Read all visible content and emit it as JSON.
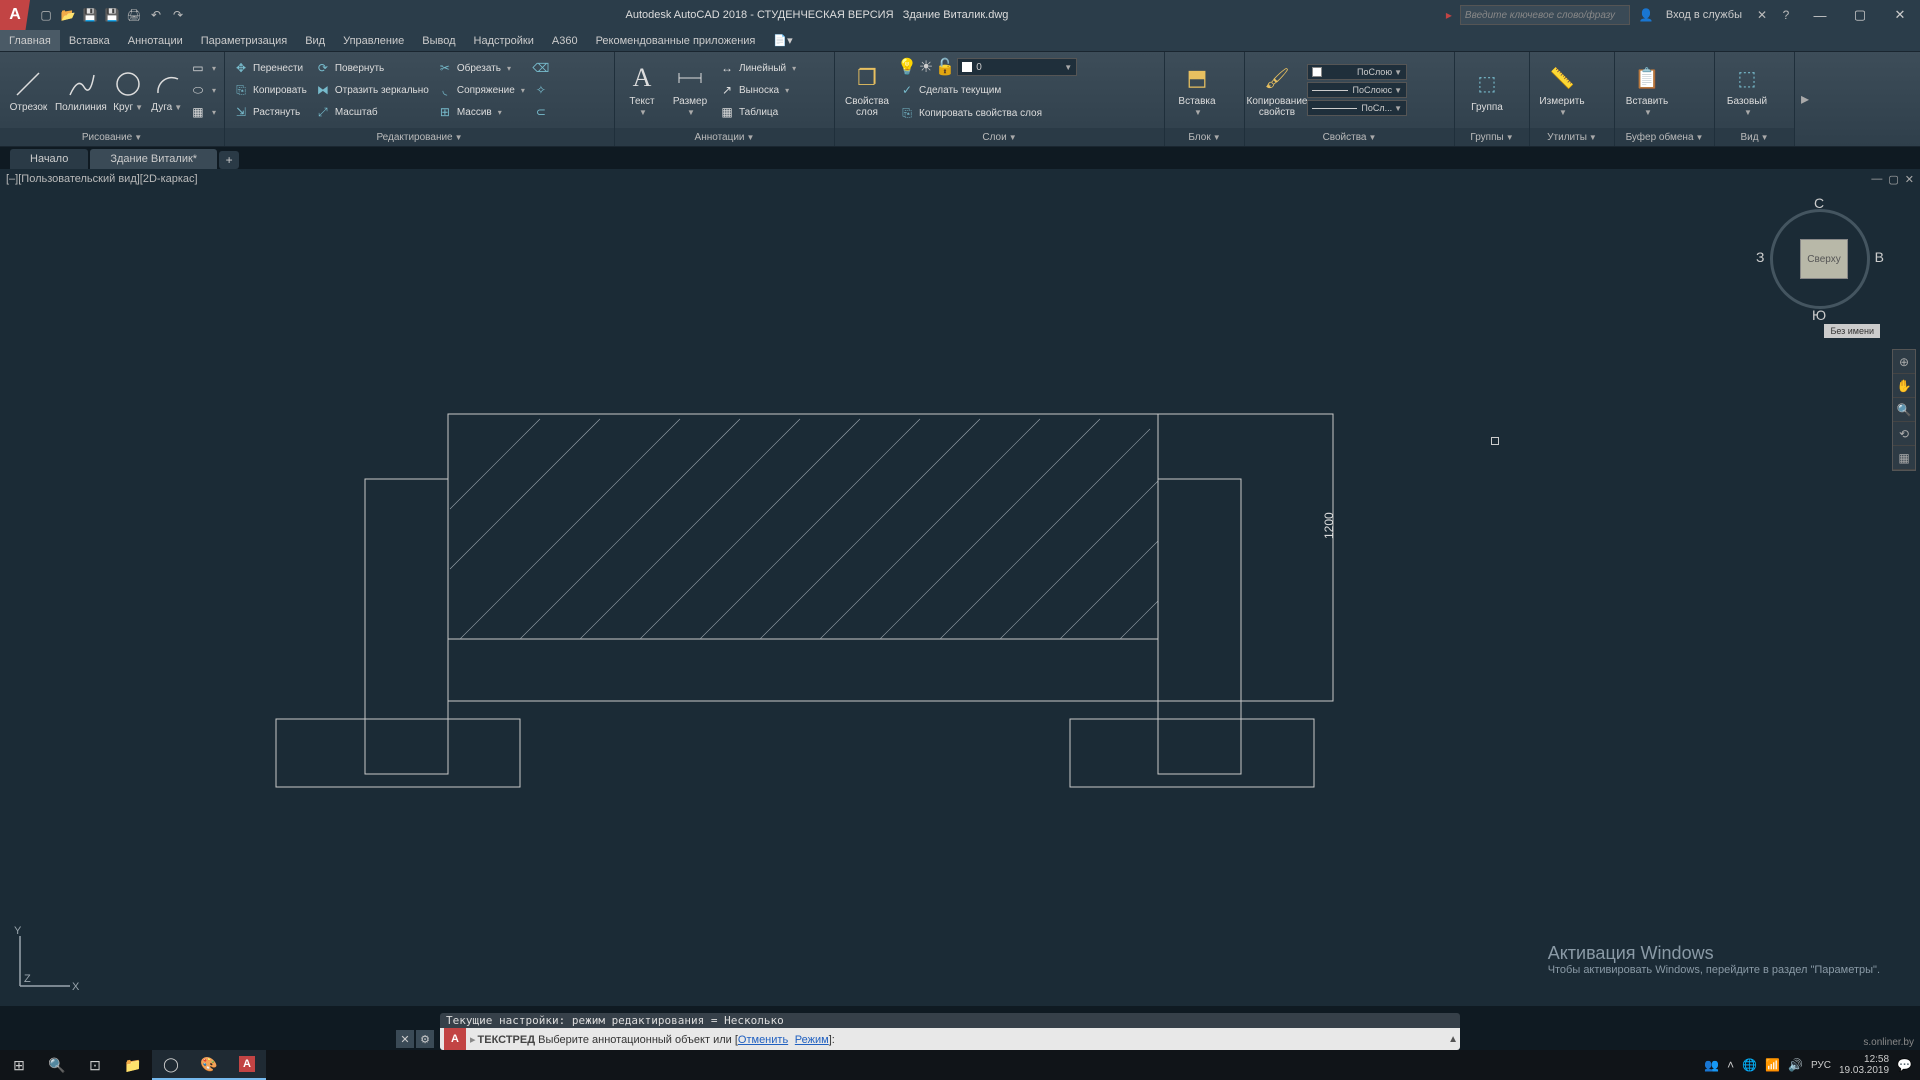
{
  "title": {
    "app": "Autodesk AutoCAD 2018 - СТУДЕНЧЕСКАЯ ВЕРСИЯ",
    "file": "Здание Виталик.dwg",
    "search_placeholder": "Введите ключевое слово/фразу",
    "signin": "Вход в службы"
  },
  "menu": [
    "Главная",
    "Вставка",
    "Аннотации",
    "Параметризация",
    "Вид",
    "Управление",
    "Вывод",
    "Надстройки",
    "A360",
    "Рекомендованные приложения"
  ],
  "ribbon": {
    "draw": {
      "title": "Рисование",
      "line": "Отрезок",
      "polyline": "Полилиния",
      "circle": "Круг",
      "arc": "Дуга"
    },
    "modify": {
      "title": "Редактирование",
      "move": "Перенести",
      "rotate": "Повернуть",
      "trim": "Обрезать",
      "copy": "Копировать",
      "mirror": "Отразить зеркально",
      "fillet": "Сопряжение",
      "stretch": "Растянуть",
      "scale": "Масштаб",
      "array": "Массив"
    },
    "annot": {
      "title": "Аннотации",
      "text": "Текст",
      "dim": "Размер",
      "linear": "Линейный",
      "leader": "Выноска",
      "table": "Таблица"
    },
    "layers": {
      "title": "Слои",
      "props": "Свойства слоя",
      "make_current": "Сделать текущим",
      "copy_props": "Копировать свойства слоя",
      "combo": "0"
    },
    "block": {
      "title": "Блок",
      "insert": "Вставка"
    },
    "props": {
      "title": "Свойства",
      "copy": "Копирование свойств",
      "bylayer": "ПоСлою",
      "byblock": "ПоСлоюс",
      "byl2": "ПоСл..."
    },
    "groups": {
      "title": "Группы",
      "group": "Группа"
    },
    "utils": {
      "title": "Утилиты",
      "measure": "Измерить"
    },
    "clip": {
      "title": "Буфер обмена",
      "paste": "Вставить"
    },
    "view": {
      "title": "Вид",
      "base": "Базовый"
    }
  },
  "tabs": {
    "start": "Начало",
    "file": "Здание Виталик*"
  },
  "viewport": {
    "label": "[–][Пользовательский вид][2D-каркас]"
  },
  "viewcube": {
    "face": "Сверху",
    "n": "С",
    "s": "Ю",
    "e": "В",
    "w": "З",
    "unnamed": "Без имени"
  },
  "dimension": {
    "value": "1200"
  },
  "watermark": {
    "title": "Активация Windows",
    "sub": "Чтобы активировать Windows, перейдите в раздел \"Параметры\"."
  },
  "cmd": {
    "history": "Текущие настройки: режим редактирования = Несколько",
    "prompt_cmd": "ТЕКСТРЕД",
    "prompt_body": " Выберите аннотационный объект или [",
    "link1": "Отменить",
    "link2": "Режим",
    "prompt_end": "]:"
  },
  "taskbar": {
    "time": "12:58",
    "date": "19.03.2019",
    "lang": "РУС",
    "site": "s.onliner.by"
  }
}
